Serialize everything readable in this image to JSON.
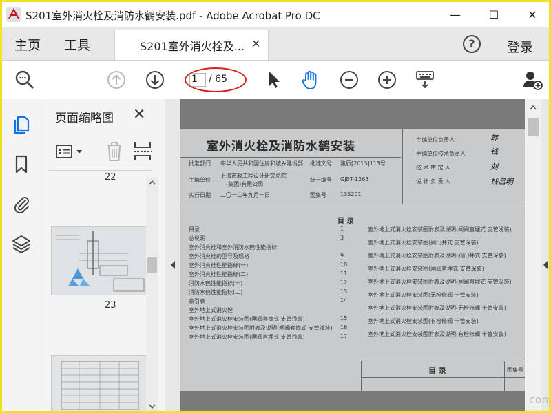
{
  "window": {
    "title": "S201室外消火栓及消防水鹤安装.pdf - Adobe Acrobat Pro DC",
    "minimize": "—",
    "maximize": "☐",
    "close": "✕"
  },
  "tabs": {
    "home": "主页",
    "tools": "工具",
    "document": "S201室外消火栓及...",
    "document_close": "✕",
    "help": "?",
    "login": "登录"
  },
  "toolbar": {
    "current_page": "1",
    "total_pages": "/ 65"
  },
  "thumbnail_panel": {
    "title": "页面缩略图",
    "close": "✕",
    "page_labels": [
      "22",
      "23"
    ]
  },
  "document": {
    "title": "室外消火栓及消防水鹤安装",
    "approval_dept_label": "批准部门",
    "approval_dept": "中华人民共和国住房和城乡建设部",
    "approval_no_label": "批准文号",
    "approval_no": "建质[2013]113号",
    "chief_unit_label": "主编单位",
    "chief_unit_line1": "上海市政工程设计研究总院",
    "chief_unit_line2": "(集团)有限公司",
    "unified_no_label": "统一编号",
    "unified_no": "GJBT-1263",
    "effective_date_label": "实行日期",
    "effective_date": "二〇一三年九月一日",
    "atlas_no_label": "图集号",
    "atlas_no": "13S201",
    "roles": [
      "主编单位负责人",
      "主编单位技术负责人",
      "技 术 审 定 人",
      "设 计 负 责 人"
    ],
    "signatures": [
      "韩",
      "钱",
      "刘",
      "钱昌明"
    ],
    "toc_heading": "目 录",
    "toc_left": [
      [
        "目录",
        "1"
      ],
      [
        "总说明",
        "3"
      ],
      [
        "室外消火栓和室外消防水鹤性能指标",
        ""
      ],
      [
        "室外消火栓的型号及规格",
        "9"
      ],
      [
        "室外消火栓性能指标(一)",
        "10"
      ],
      [
        "室外消火栓性能指标(二)",
        "11"
      ],
      [
        "消防水鹤性能指标(一)",
        "12"
      ],
      [
        "消防水鹤性能指标(二)",
        "13"
      ],
      [
        "索引表",
        "14"
      ],
      [
        "室外地上式消火栓",
        ""
      ],
      [
        "室外地上式消火栓安装图(闸阀套筒式 支管浅装)",
        "15"
      ],
      [
        "室外地上式消火栓安装图附表及说明(闸阀套筒式 支管浅装)",
        "16"
      ],
      [
        "室外地上式消火栓安装图(闸阀直埋式 支管浅装)",
        "17"
      ]
    ],
    "toc_right": [
      "室外地上式消火栓安装图附表及说明(闸阀直埋式 支管浅装)",
      "室外地上式消火栓安装图(阀门井式 支管深装)",
      "室外地上式消火栓安装图附表及说明(阀门井式 支管深装)",
      "室外地上式消火栓安装图(闸阀直埋式 支管深装)",
      "室外地上式消火栓安装图附表及说明(闸阀直埋式 支管深装)",
      "室外地上式消火栓安装图(无检修阀 干管安装)",
      "室外地上式消火栓安装图附表及说明(无检修阀 干管安装)",
      "室外地上式消火栓安装图(有检修阀 干管安装)",
      "室外地上式消火栓安装图附表及说明(有检修阀 干管安装)"
    ],
    "footer_heading": "目 录",
    "footer_atlas_label": "图集号"
  },
  "watermark": "com"
}
